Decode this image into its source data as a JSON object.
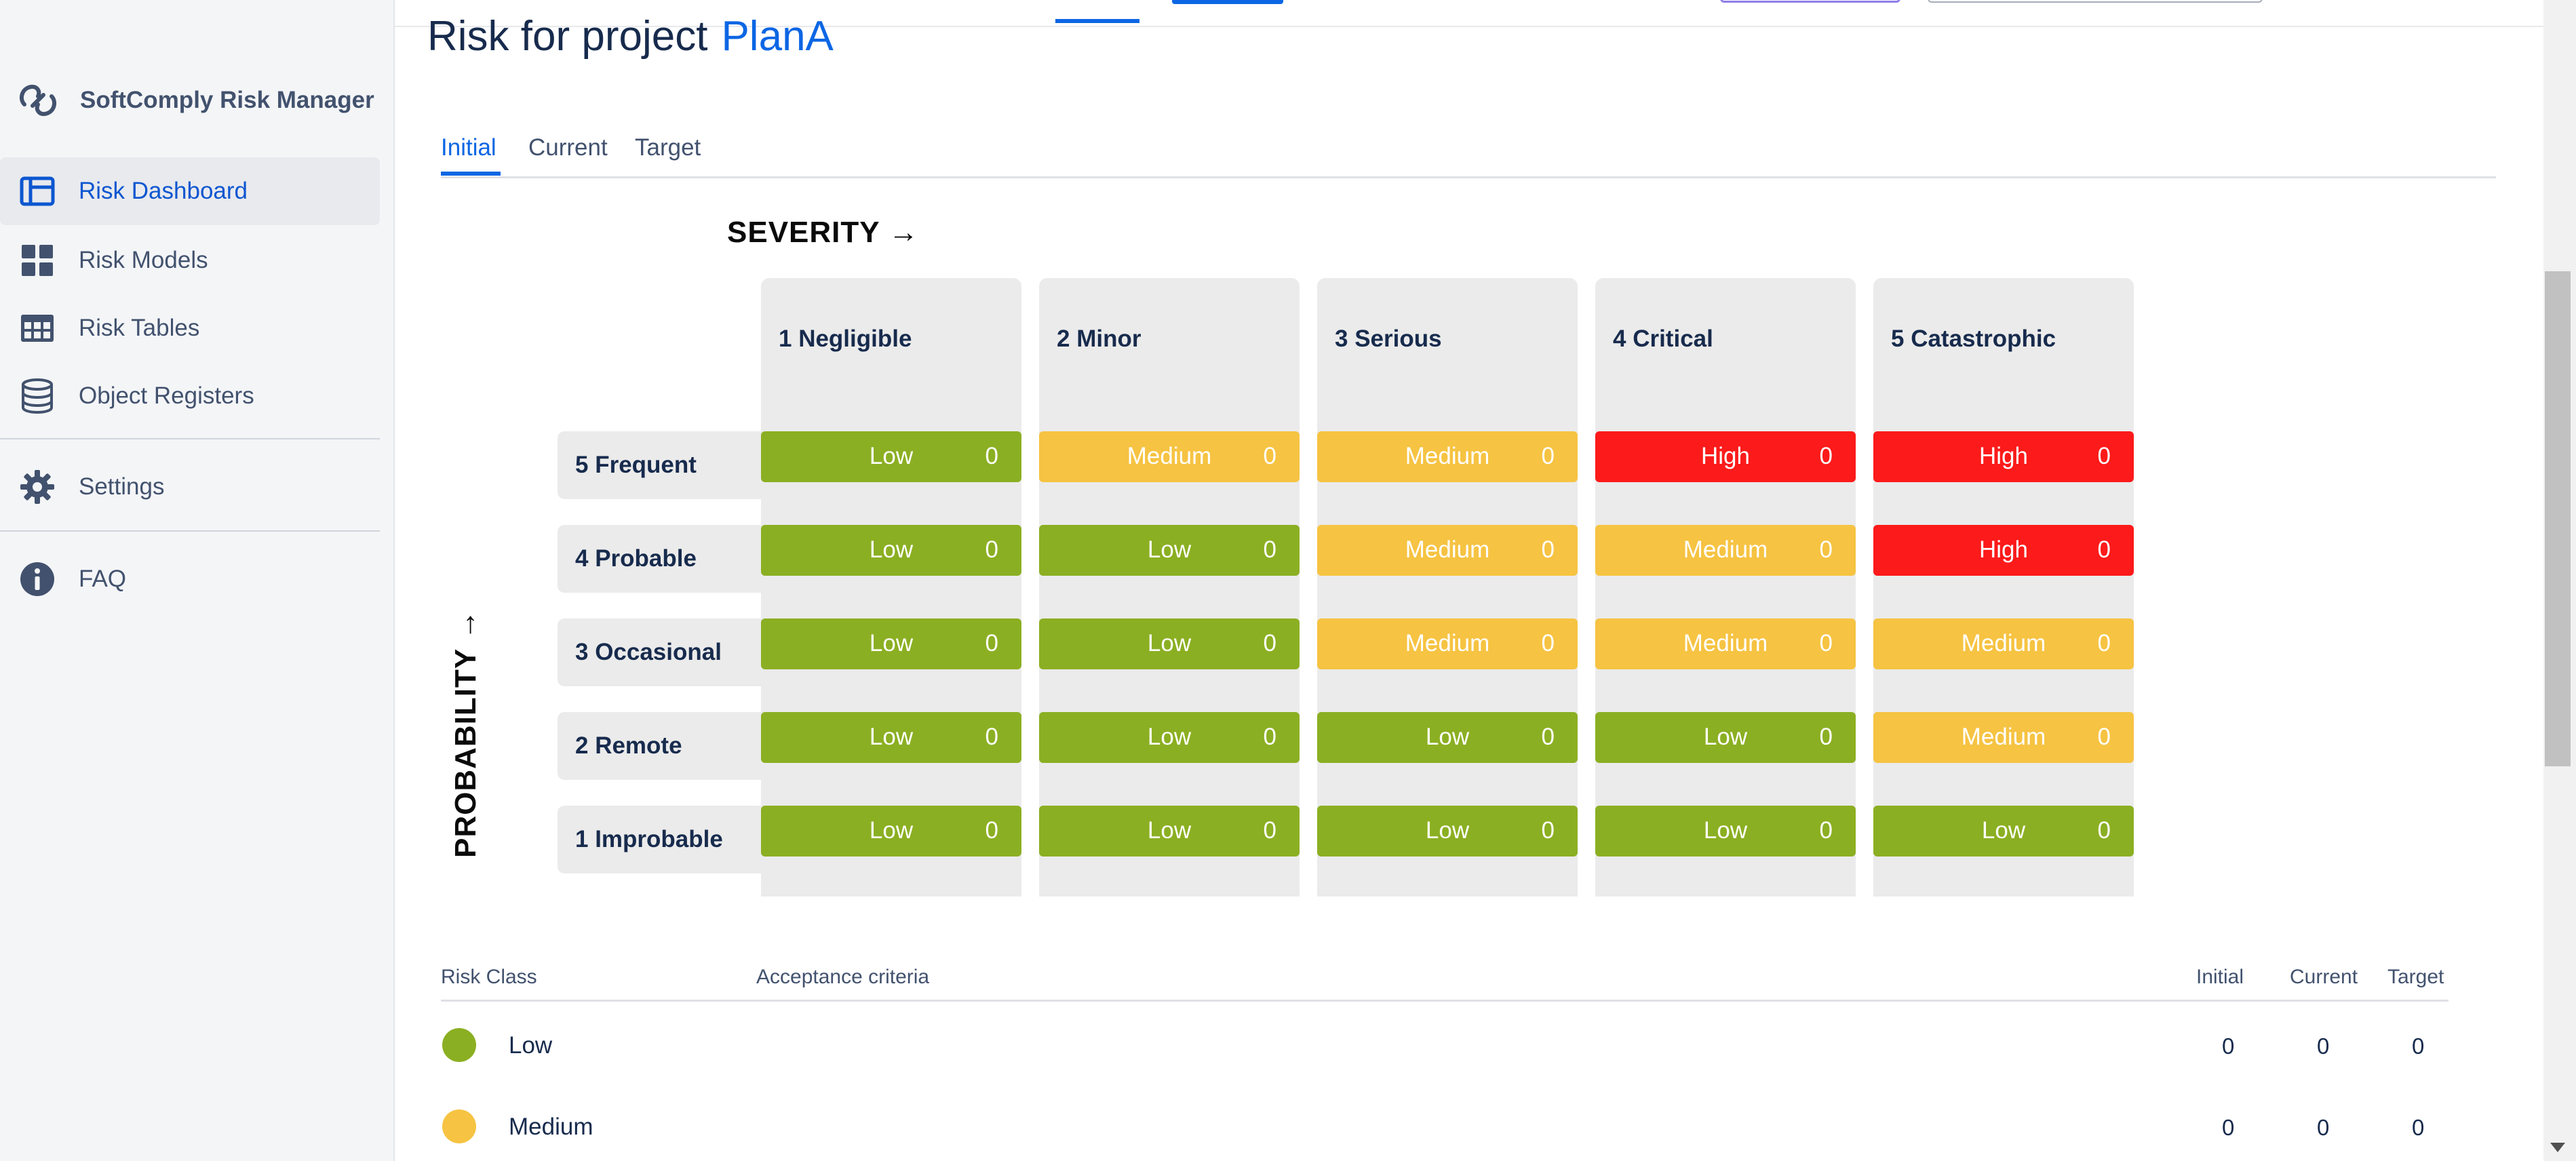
{
  "app": {
    "name": "SoftComply Risk Manager"
  },
  "sidebar": {
    "items": [
      {
        "label": "Risk Dashboard",
        "icon": "dashboard-icon",
        "active": true
      },
      {
        "label": "Risk Models",
        "icon": "grid-icon"
      },
      {
        "label": "Risk Tables",
        "icon": "table-icon"
      },
      {
        "label": "Object Registers",
        "icon": "database-icon"
      },
      {
        "label": "Settings",
        "icon": "gear-icon"
      },
      {
        "label": "FAQ",
        "icon": "info-icon"
      }
    ]
  },
  "page": {
    "title_prefix": "Risk for project",
    "project": "PlanA"
  },
  "tabs": [
    {
      "label": "Initial",
      "active": true
    },
    {
      "label": "Current"
    },
    {
      "label": "Target"
    }
  ],
  "matrix": {
    "severity_label": "SEVERITY →",
    "probability_label": "PROBABILITY →",
    "severity_levels": [
      "1 Negligible",
      "2 Minor",
      "3 Serious",
      "4 Critical",
      "5 Catastrophic"
    ],
    "probability_levels": [
      "5 Frequent",
      "4 Probable",
      "3 Occasional",
      "2 Remote",
      "1 Improbable"
    ],
    "rows": [
      [
        {
          "level": "Low",
          "count": "0"
        },
        {
          "level": "Medium",
          "count": "0"
        },
        {
          "level": "Medium",
          "count": "0"
        },
        {
          "level": "High",
          "count": "0"
        },
        {
          "level": "High",
          "count": "0"
        }
      ],
      [
        {
          "level": "Low",
          "count": "0"
        },
        {
          "level": "Low",
          "count": "0"
        },
        {
          "level": "Medium",
          "count": "0"
        },
        {
          "level": "Medium",
          "count": "0"
        },
        {
          "level": "High",
          "count": "0"
        }
      ],
      [
        {
          "level": "Low",
          "count": "0"
        },
        {
          "level": "Low",
          "count": "0"
        },
        {
          "level": "Medium",
          "count": "0"
        },
        {
          "level": "Medium",
          "count": "0"
        },
        {
          "level": "Medium",
          "count": "0"
        }
      ],
      [
        {
          "level": "Low",
          "count": "0"
        },
        {
          "level": "Low",
          "count": "0"
        },
        {
          "level": "Low",
          "count": "0"
        },
        {
          "level": "Low",
          "count": "0"
        },
        {
          "level": "Medium",
          "count": "0"
        }
      ],
      [
        {
          "level": "Low",
          "count": "0"
        },
        {
          "level": "Low",
          "count": "0"
        },
        {
          "level": "Low",
          "count": "0"
        },
        {
          "level": "Low",
          "count": "0"
        },
        {
          "level": "Low",
          "count": "0"
        }
      ]
    ]
  },
  "risk_table": {
    "headers": {
      "risk_class": "Risk Class",
      "acceptance": "Acceptance criteria",
      "initial": "Initial",
      "current": "Current",
      "target": "Target"
    },
    "rows": [
      {
        "name": "Low",
        "color": "#8BAF22",
        "initial": "0",
        "current": "0",
        "target": "0"
      },
      {
        "name": "Medium",
        "color": "#F6C342",
        "initial": "0",
        "current": "0",
        "target": "0"
      }
    ]
  },
  "colors": {
    "low": "#8BAF22",
    "medium": "#F6C342",
    "high": "#FC1A1A",
    "accent": "#0C66E4"
  }
}
